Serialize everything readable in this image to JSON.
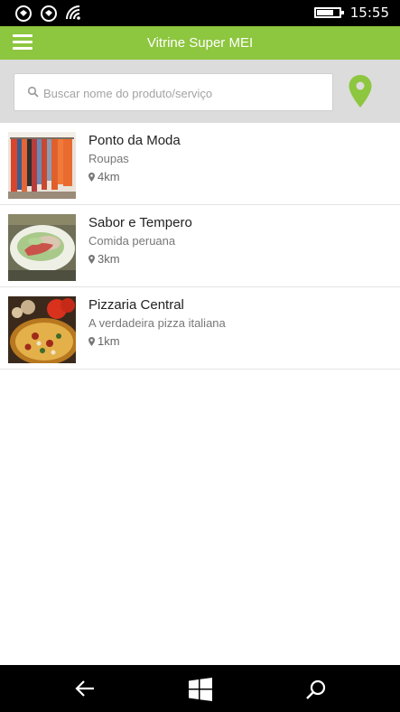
{
  "status_bar": {
    "time": "15:55",
    "icons": [
      "notification-icon",
      "notification-icon",
      "wifi-icon",
      "battery-icon"
    ]
  },
  "header": {
    "title": "Vitrine Super MEI",
    "menu_icon": "hamburger-menu-icon"
  },
  "search": {
    "placeholder": "Buscar nome do produto/serviço",
    "value": "",
    "location_icon": "location-pin-icon"
  },
  "listings": [
    {
      "name": "Ponto da Moda",
      "category": "Roupas",
      "distance": "4km",
      "image": "clothing-rack-photo"
    },
    {
      "name": "Sabor e Tempero",
      "category": "Comida peruana",
      "distance": "3km",
      "image": "peruvian-food-photo"
    },
    {
      "name": "Pizzaria Central",
      "category": "A verdadeira pizza italiana",
      "distance": "1km",
      "image": "pizza-photo"
    }
  ],
  "nav": {
    "icons": [
      "back-arrow-icon",
      "windows-start-icon",
      "search-icon"
    ]
  },
  "colors": {
    "accent": "#8dc63f",
    "search_band": "#dcdcdc"
  }
}
